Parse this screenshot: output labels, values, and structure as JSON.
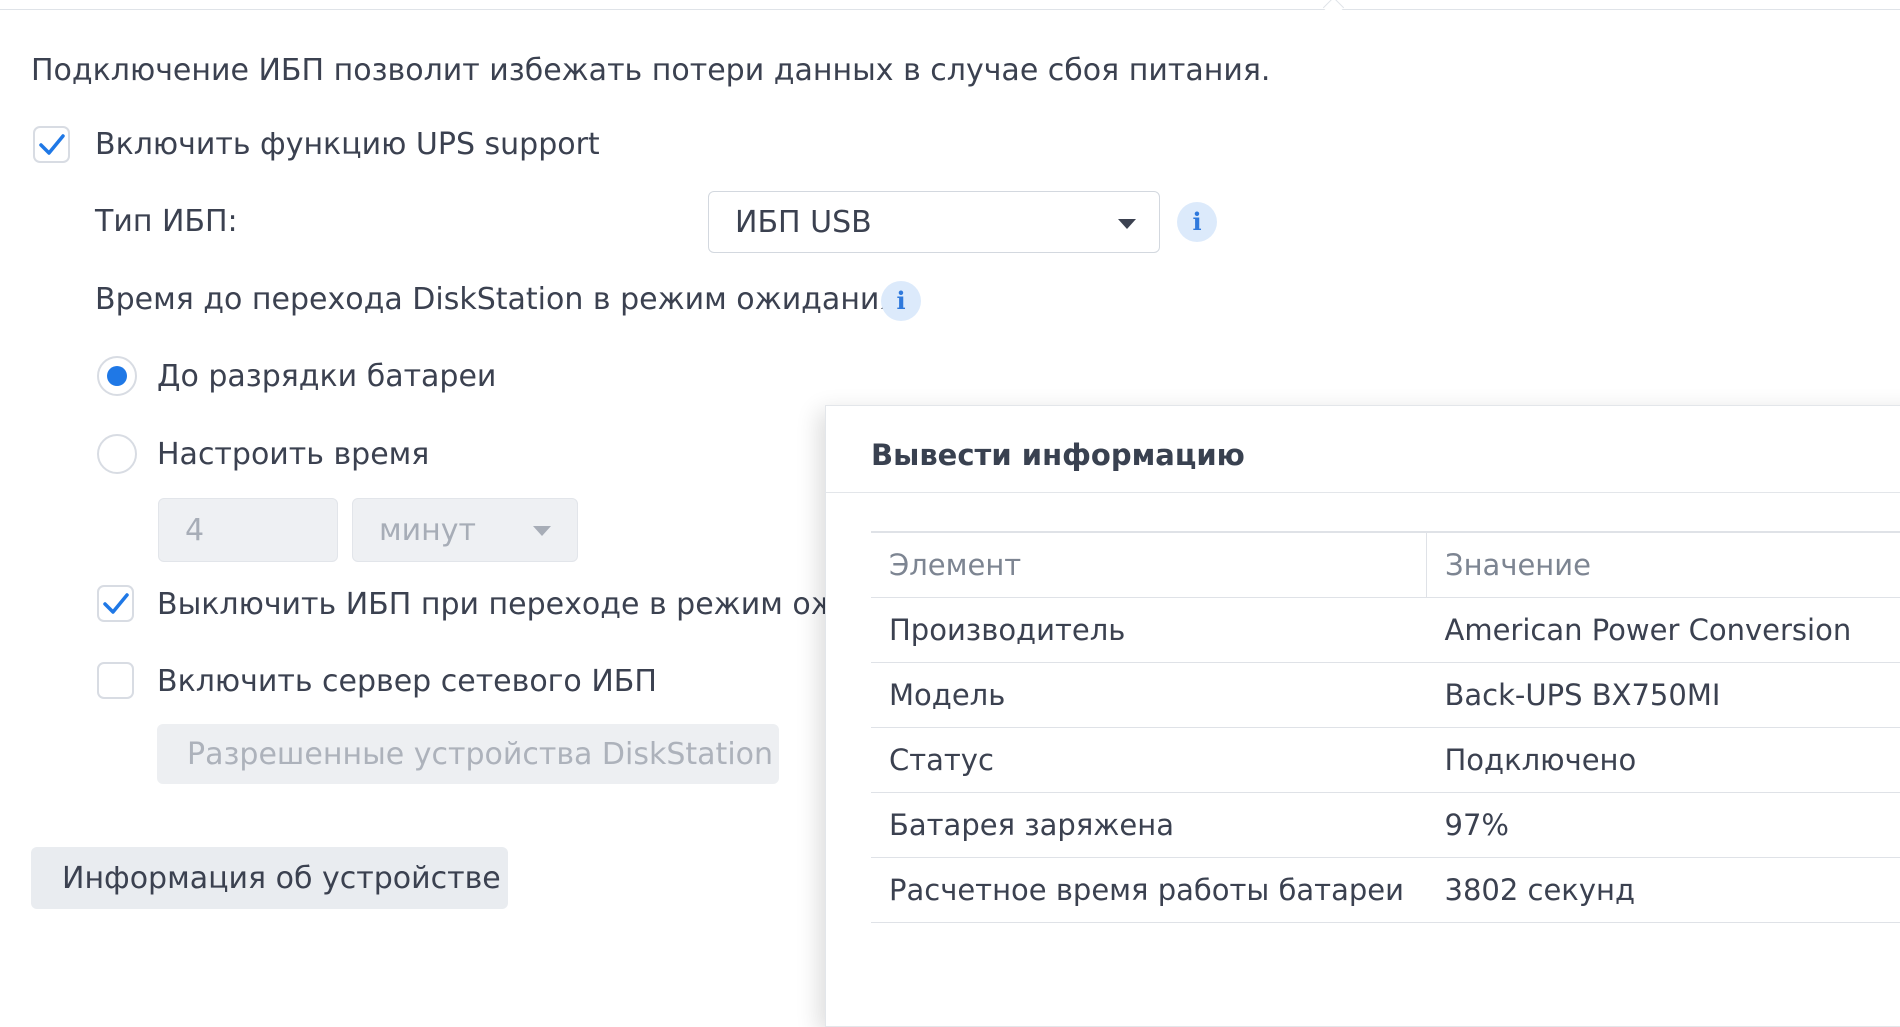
{
  "description": "Подключение ИБП позволит избежать потери данных в случае сбоя питания.",
  "enable_ups": {
    "label": "Включить функцию UPS support",
    "checked": true
  },
  "ups_type": {
    "label": "Тип ИБП:",
    "value": "ИБП USB"
  },
  "standby_time": {
    "label": "Время до перехода DiskStation в режим ожидания",
    "option_battery": {
      "label": "До разрядки батареи",
      "selected": true
    },
    "option_custom": {
      "label": "Настроить время",
      "selected": false
    },
    "time_value": "4",
    "time_unit": "минут"
  },
  "shutdown_ups": {
    "label": "Выключить ИБП при переходе в режим ожид",
    "checked": true
  },
  "network_server": {
    "label": "Включить сервер сетевого ИБП",
    "checked": false
  },
  "permitted_devices_button": "Разрешенные устройства DiskStation",
  "device_info_button": "Информация об устройстве",
  "modal": {
    "title": "Вывести информацию",
    "columns": [
      "Элемент",
      "Значение"
    ],
    "rows": [
      [
        "Производитель",
        "American Power Conversion"
      ],
      [
        "Модель",
        "Back-UPS BX750MI"
      ],
      [
        "Статус",
        "Подключено"
      ],
      [
        "Батарея заряжена",
        "97%"
      ],
      [
        "Расчетное время работы батареи",
        "3802 секунд"
      ]
    ]
  },
  "colors": {
    "accent": "#1f78e6",
    "text": "#3b4150",
    "muted": "#7d8592"
  },
  "icons": [
    "check-icon",
    "info-icon",
    "caret-down-icon"
  ]
}
